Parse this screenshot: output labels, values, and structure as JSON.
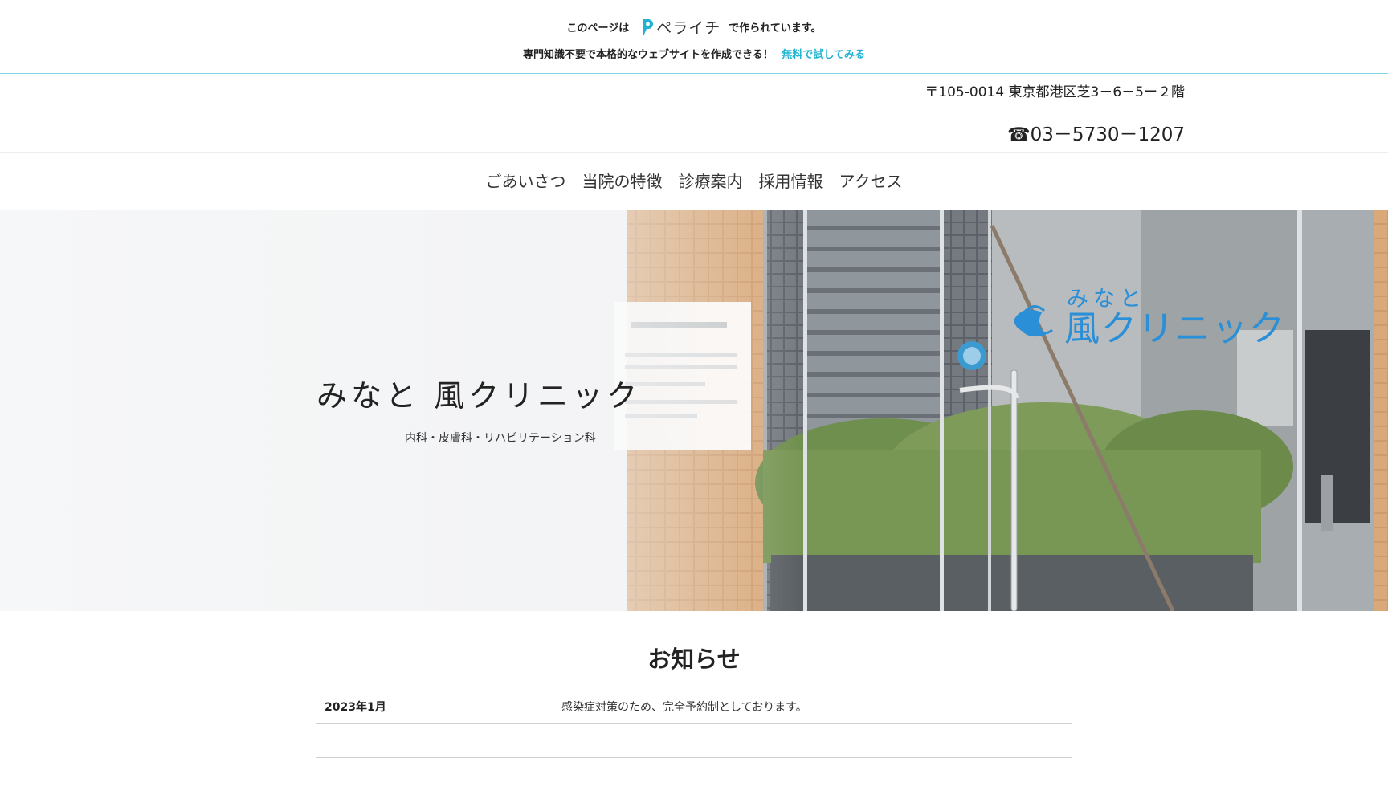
{
  "promo": {
    "prefix": "このページは",
    "logo_text": "ペライチ",
    "suffix": "で作られています。",
    "tagline": "専門知識不要で本格的なウェブサイトを作成できる！",
    "link_label": "無料で試してみる"
  },
  "header": {
    "address": "〒105-0014 東京都港区芝3－6－5ー２階",
    "phone": "☎03－5730－1207"
  },
  "nav": {
    "items": [
      "ごあいさつ",
      "当院の特徴",
      "診療案内",
      "採用情報",
      "アクセス"
    ]
  },
  "hero": {
    "title": "みなと 風クリニック",
    "subtitle": "内科・皮膚科・リハビリテーション科",
    "door_sign_small": "みなと",
    "door_sign_main": "風クリニック"
  },
  "news": {
    "heading": "お知らせ",
    "items": [
      {
        "date": "2023年1月",
        "text": "感染症対策のため、完全予約制としております。"
      }
    ]
  },
  "colors": {
    "accent": "#1fb3cf",
    "door_sign": "#2a8fd6"
  }
}
